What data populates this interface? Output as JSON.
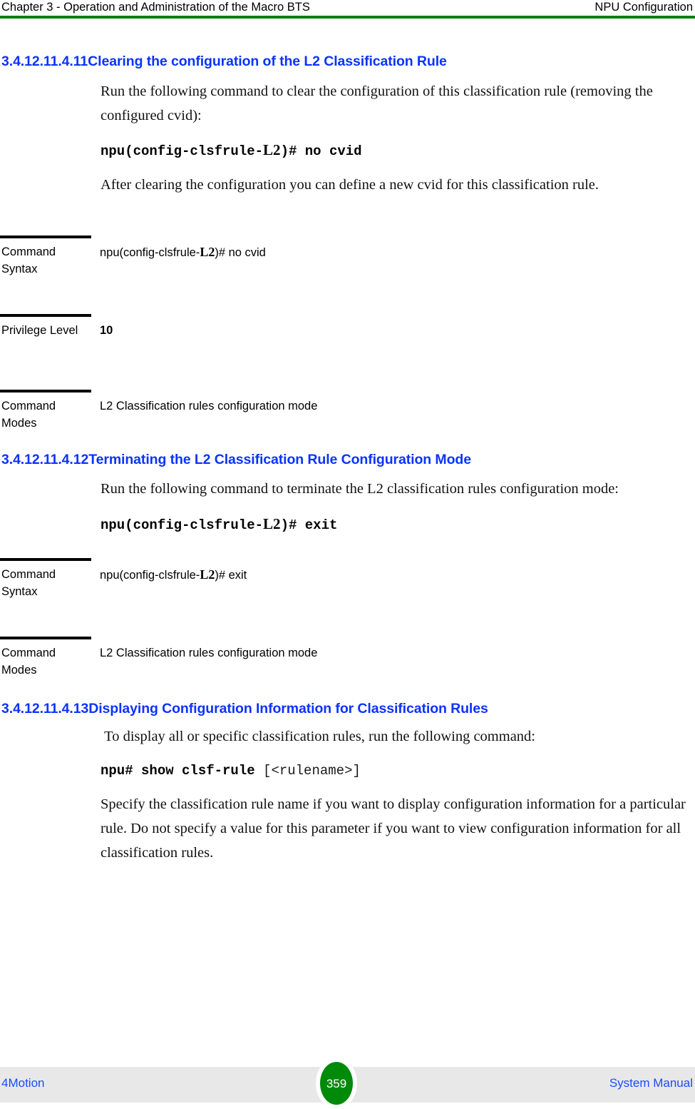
{
  "header": {
    "left": "Chapter 3 - Operation and Administration of the Macro BTS",
    "right": "NPU Configuration",
    "rule_color": "#008000"
  },
  "sections": [
    {
      "number": "3.4.12.11.4.11",
      "title": "Clearing the configuration of the L2 Classification Rule",
      "intro": "Run the following command to clear the configuration of this classification rule (removing the configured cvid):",
      "command_prefix": "npu(config-clsfrule-",
      "command_l2": "L2",
      "command_suffix": ")# no cvid",
      "after": "After clearing the configuration you can define a new cvid for this classification rule.",
      "table": [
        {
          "label": "Command Syntax",
          "value_prefix": "npu(config-clsfrule-",
          "value_l2": "L2",
          "value_suffix": ")# no cvid"
        },
        {
          "label": "Privilege Level",
          "value": "10"
        },
        {
          "label": "Command Modes",
          "value": "L2 Classification rules configuration mode"
        }
      ]
    },
    {
      "number": "3.4.12.11.4.12",
      "title": "Terminating the L2 Classification Rule Configuration Mode",
      "intro": "Run the following command to terminate the L2 classification rules configuration mode:",
      "command_prefix": "npu(config-clsfrule-",
      "command_l2": "L2",
      "command_suffix": ")# exit",
      "table": [
        {
          "label": "Command Syntax",
          "value_prefix": "npu(config-clsfrule-",
          "value_l2": "L2",
          "value_suffix": ")# exit"
        },
        {
          "label": "Command Modes",
          "value": "L2 Classification rules configuration mode"
        }
      ]
    },
    {
      "number": "3.4.12.11.4.13",
      "title": "Displaying Configuration Information for Classification Rules",
      "intro": " To display all or specific classification rules, run the following command:",
      "command_main": "npu# show clsf-rule",
      "command_optional": "[<rulename>]",
      "after": "Specify the classification rule name if you want to display configuration information for a particular rule. Do not specify a value for this parameter if you want to view configuration information for all classification rules."
    }
  ],
  "footer": {
    "left": "4Motion",
    "page_number": "359",
    "right": "System Manual",
    "badge_color": "#008a09",
    "band_color": "#e8e8e8"
  }
}
